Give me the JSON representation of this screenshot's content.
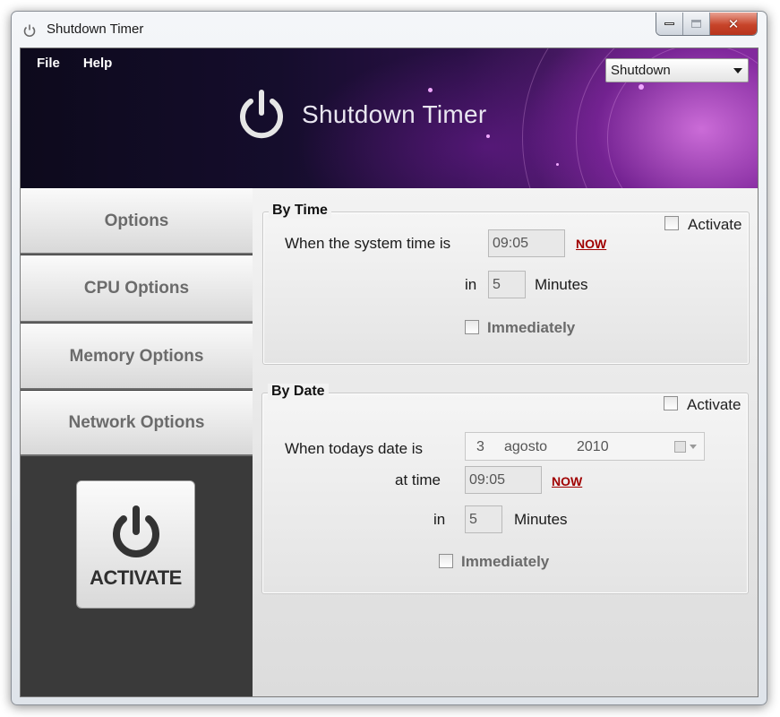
{
  "window": {
    "title": "Shutdown Timer"
  },
  "menu": {
    "file": "File",
    "help": "Help"
  },
  "banner": {
    "title": "Shutdown Timer"
  },
  "mode_select": {
    "value": "Shutdown"
  },
  "sidebar": {
    "items": [
      {
        "label": "Options"
      },
      {
        "label": "CPU Options"
      },
      {
        "label": "Memory Options"
      },
      {
        "label": "Network Options"
      }
    ],
    "activate_label": "ACTIVATE"
  },
  "by_time": {
    "title": "By Time",
    "activate_label": "Activate",
    "system_time_label": "When the system time is",
    "time_value": "09:05",
    "now_label": "NOW",
    "in_label": "in",
    "minutes_value": "5",
    "minutes_label": "Minutes",
    "immediately_label": "Immediately"
  },
  "by_date": {
    "title": "By Date",
    "activate_label": "Activate",
    "date_label": "When todays date is",
    "date_day": "3",
    "date_month": "agosto",
    "date_year": "2010",
    "at_time_label": "at time",
    "time_value": "09:05",
    "now_label": "NOW",
    "in_label": "in",
    "minutes_value": "5",
    "minutes_label": "Minutes",
    "immediately_label": "Immediately"
  },
  "colors": {
    "now_link": "#a00000",
    "sidebar_bg": "#3a3a3a",
    "banner_accent": "#7a2d92"
  }
}
